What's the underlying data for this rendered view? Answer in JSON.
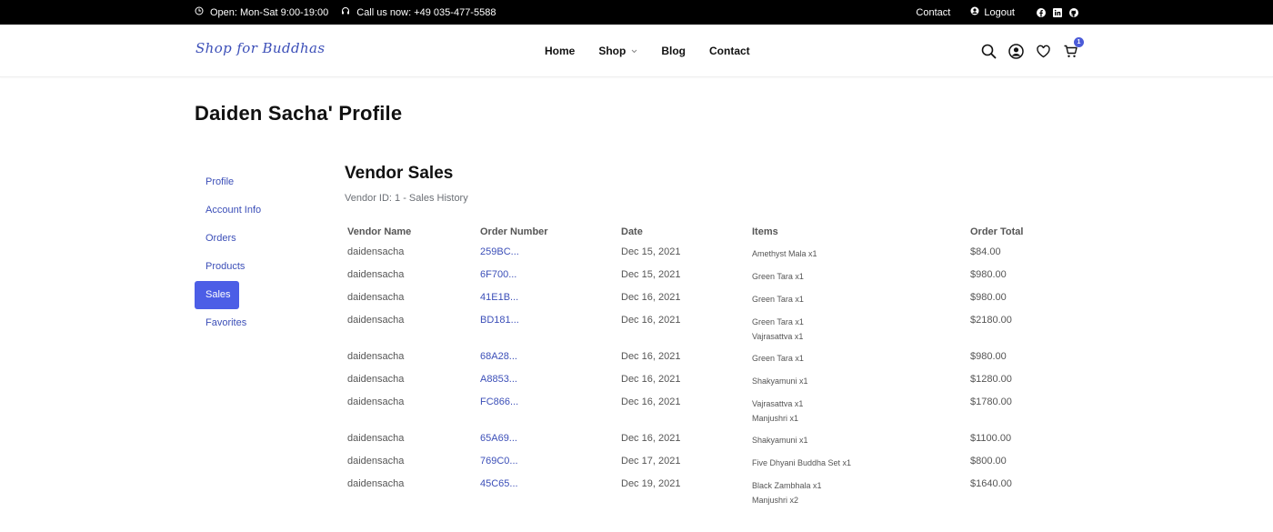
{
  "topbar": {
    "hours": "Open: Mon-Sat 9:00-19:00",
    "phone": "Call us now: +49 035-477-5588",
    "contact": "Contact",
    "logout": "Logout"
  },
  "header": {
    "logo": "Shop for Buddhas",
    "nav": {
      "home": "Home",
      "shop": "Shop",
      "blog": "Blog",
      "contact": "Contact"
    },
    "cart_count": "1"
  },
  "page_title": "Daiden Sacha' Profile",
  "sidebar": {
    "items": [
      {
        "label": "Profile"
      },
      {
        "label": "Account Info"
      },
      {
        "label": "Orders"
      },
      {
        "label": "Products"
      },
      {
        "label": "Sales"
      },
      {
        "label": "Favorites"
      }
    ],
    "active": "Sales"
  },
  "main": {
    "title": "Vendor Sales",
    "subtitle": "Vendor ID: 1 - Sales History",
    "columns": [
      "Vendor Name",
      "Order Number",
      "Date",
      "Items",
      "Order Total"
    ],
    "rows": [
      {
        "vendor": "daidensacha",
        "order": "259BC...",
        "date": "Dec 15, 2021",
        "items": [
          "Amethyst Mala x1"
        ],
        "total": "$84.00"
      },
      {
        "vendor": "daidensacha",
        "order": "6F700...",
        "date": "Dec 15, 2021",
        "items": [
          "Green Tara x1"
        ],
        "total": "$980.00"
      },
      {
        "vendor": "daidensacha",
        "order": "41E1B...",
        "date": "Dec 16, 2021",
        "items": [
          "Green Tara x1"
        ],
        "total": "$980.00"
      },
      {
        "vendor": "daidensacha",
        "order": "BD181...",
        "date": "Dec 16, 2021",
        "items": [
          "Green Tara x1",
          "Vajrasattva x1"
        ],
        "total": "$2180.00"
      },
      {
        "vendor": "daidensacha",
        "order": "68A28...",
        "date": "Dec 16, 2021",
        "items": [
          "Green Tara x1"
        ],
        "total": "$980.00"
      },
      {
        "vendor": "daidensacha",
        "order": "A8853...",
        "date": "Dec 16, 2021",
        "items": [
          "Shakyamuni x1"
        ],
        "total": "$1280.00"
      },
      {
        "vendor": "daidensacha",
        "order": "FC866...",
        "date": "Dec 16, 2021",
        "items": [
          "Vajrasattva x1",
          "Manjushri x1"
        ],
        "total": "$1780.00"
      },
      {
        "vendor": "daidensacha",
        "order": "65A69...",
        "date": "Dec 16, 2021",
        "items": [
          "Shakyamuni x1"
        ],
        "total": "$1100.00"
      },
      {
        "vendor": "daidensacha",
        "order": "769C0...",
        "date": "Dec 17, 2021",
        "items": [
          "Five Dhyani Buddha Set x1"
        ],
        "total": "$800.00"
      },
      {
        "vendor": "daidensacha",
        "order": "45C65...",
        "date": "Dec 19, 2021",
        "items": [
          "Black Zambhala x1",
          "Manjushri x2"
        ],
        "total": "$1640.00"
      }
    ]
  },
  "colors": {
    "accent": "#4c5ee6",
    "link": "#3c4fb8",
    "topbar_bg": "#000000"
  }
}
